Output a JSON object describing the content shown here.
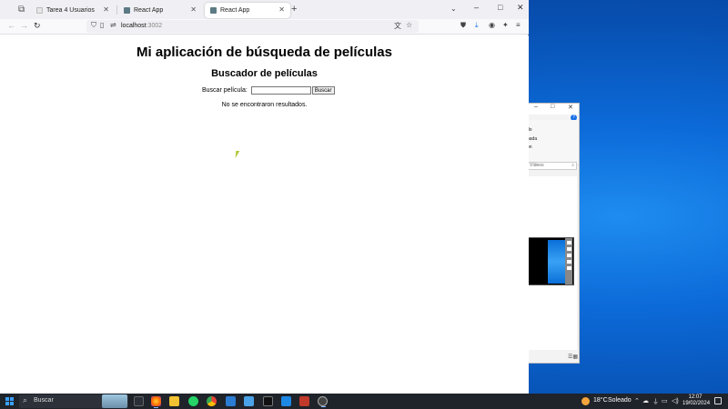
{
  "browser": {
    "tabs": [
      {
        "title": "Tarea 4 Usuarios",
        "active": false
      },
      {
        "title": "React App",
        "active": false
      },
      {
        "title": "React App",
        "active": true
      }
    ],
    "new_tab_glyph": "+",
    "url_host": "localhost",
    "url_port": ":3002",
    "icons": [
      "tab-overview-icon",
      "back-icon",
      "forward-icon",
      "reload-icon",
      "shield-icon",
      "page-icon",
      "permissions-icon",
      "translate-icon",
      "bookmark-star-icon",
      "pocket-icon",
      "download-icon",
      "account-icon",
      "extensions-icon",
      "menu-icon"
    ]
  },
  "page": {
    "title": "Mi aplicación de búsqueda de películas",
    "subtitle": "Buscador de películas",
    "search_label": "Buscar película:",
    "search_value": "",
    "search_button": "Buscar",
    "message": "No se encontraron resultados."
  },
  "explorer": {
    "ribbon_lines": [
      "do",
      "nada",
      "ón"
    ],
    "search_placeholder": "Vídeos"
  },
  "taskbar": {
    "search_placeholder": "Buscar",
    "weather_temp": "18°C",
    "weather_text": "Soleado",
    "time": "12:07",
    "date": "19/02/2024",
    "accent": "#3aa0ff"
  }
}
